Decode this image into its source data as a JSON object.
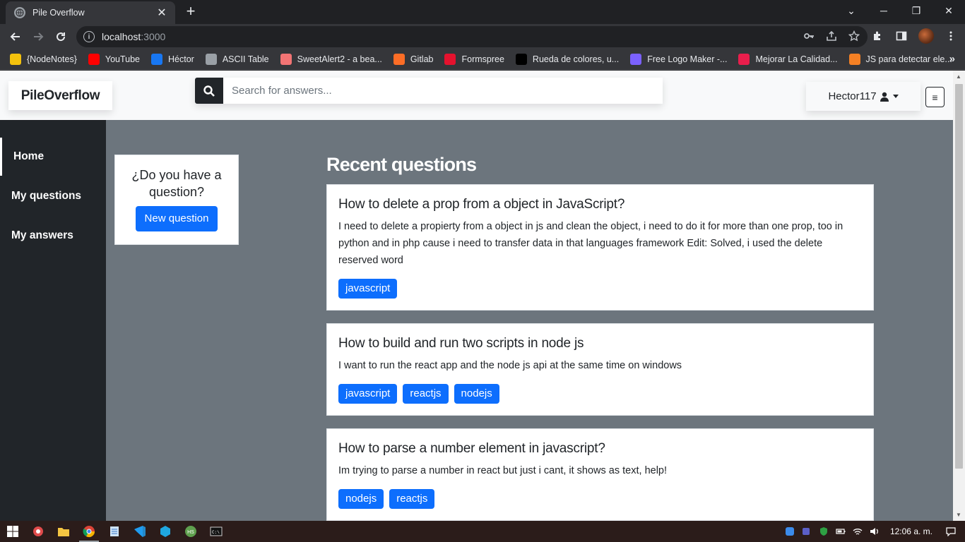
{
  "browser": {
    "tab_title": "Pile Overflow",
    "url_host": "localhost",
    "url_port": ":3000",
    "bookmarks": [
      {
        "label": "{NodeNotes}",
        "color": "#f4c20d"
      },
      {
        "label": "YouTube",
        "color": "#ff0000"
      },
      {
        "label": "Héctor",
        "color": "#1877f2"
      },
      {
        "label": "ASCII Table",
        "color": "#9aa0a6"
      },
      {
        "label": "SweetAlert2 - a bea...",
        "color": "#f27474"
      },
      {
        "label": "Gitlab",
        "color": "#fc6d26"
      },
      {
        "label": "Formspree",
        "color": "#e5122e"
      },
      {
        "label": "Rueda de colores, u...",
        "color": "#000000"
      },
      {
        "label": "Free Logo Maker -...",
        "color": "#7b61ff"
      },
      {
        "label": "Mejorar La Calidad...",
        "color": "#e91e4c"
      },
      {
        "label": "JS para detectar ele...",
        "color": "#f48024"
      }
    ]
  },
  "navbar": {
    "brand": "PileOverflow",
    "search_placeholder": "Search for answers...",
    "username": "Hector117"
  },
  "sidebar": {
    "items": [
      {
        "label": "Home"
      },
      {
        "label": "My questions"
      },
      {
        "label": "My answers"
      }
    ]
  },
  "ask_card": {
    "text": "¿Do you have a question?",
    "button": "New question"
  },
  "main": {
    "title": "Recent questions",
    "questions": [
      {
        "title": "How to delete a prop from a object in JavaScript?",
        "body": "I need to delete a propierty from a object in js and clean the object, i need to do it for more than one prop, too in python and in php cause i need to transfer data in that languages framework Edit: Solved, i used the delete reserved word",
        "tags": [
          "javascript"
        ]
      },
      {
        "title": "How to build and run two scripts in node js",
        "body": "I want to run the react app and the node js api at the same time on windows",
        "tags": [
          "javascript",
          "reactjs",
          "nodejs"
        ]
      },
      {
        "title": "How to parse a number element in javascript?",
        "body": "Im trying to parse a number in react but just i cant, it shows as text, help!",
        "tags": [
          "nodejs",
          "reactjs"
        ]
      }
    ]
  },
  "taskbar": {
    "clock": "12:06 a. m."
  },
  "colors": {
    "primary": "#0d6efd",
    "sidebar": "#212529",
    "content_bg": "#6c757d"
  }
}
